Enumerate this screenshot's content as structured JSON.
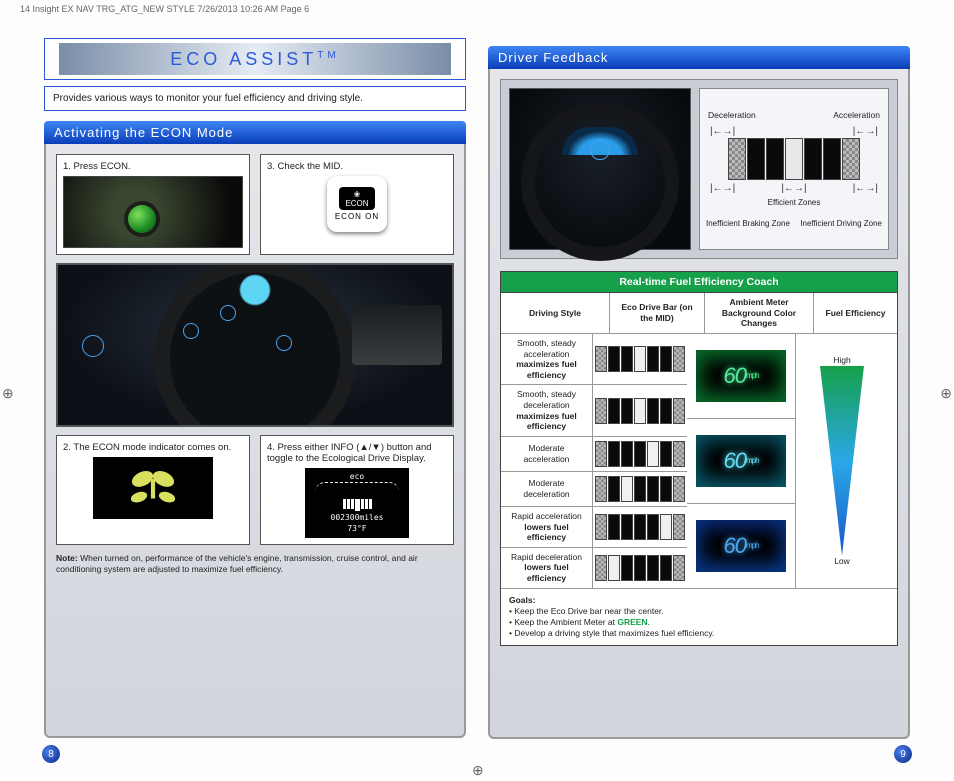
{
  "header": "14 Insight EX NAV TRG_ATG_NEW STYLE  7/26/2013  10:26 AM  Page 6",
  "left": {
    "title": "ECO ASSIST",
    "tm": "TM",
    "intro": "Provides various ways to monitor your fuel efficiency and driving style.",
    "section": "Activating the ECON Mode",
    "step1": "1.  Press ECON.",
    "step2_a": "2.  The ECON mode indicator comes on.",
    "step3": "3.  Check the MID.",
    "mid_icon_label": "ECON",
    "mid_icon_on": "ECON ON",
    "step4": "4.  Press either INFO (▲/▼) button and toggle to the Ecological Drive Display.",
    "eco_disp_top": "eco",
    "eco_disp_odo": "002300miles",
    "eco_disp_temp": "73°F",
    "note_b": "Note:",
    "note": " When turned on, performance of the vehicle's engine, transmission, cruise control, and air conditioning system are adjusted to maximize fuel efficiency.",
    "page": "8"
  },
  "right": {
    "section": "Driver Feedback",
    "zones": {
      "decel": "Deceleration",
      "accel": "Acceleration",
      "eff": "Efficient Zones",
      "ineff_brake": "Inefficient Braking Zone",
      "ineff_drive": "Inefficient Driving Zone"
    },
    "table": {
      "title": "Real-time Fuel Efficiency Coach",
      "headers": [
        "Driving Style",
        "Eco Drive Bar (on the MID)",
        "Ambient Meter Background Color Changes",
        "Fuel Efficiency"
      ],
      "rows": [
        {
          "style_a": "Smooth, steady acceleration",
          "style_b": "maximizes fuel efficiency"
        },
        {
          "style_a": "Smooth, steady deceleration",
          "style_b": "maximizes fuel efficiency"
        },
        {
          "style_a": "Moderate acceleration",
          "style_b": ""
        },
        {
          "style_a": "Moderate deceleration",
          "style_b": ""
        },
        {
          "style_a": "Rapid acceleration",
          "style_b": "lowers fuel efficiency"
        },
        {
          "style_a": "Rapid deceleration",
          "style_b": "lowers fuel efficiency"
        }
      ],
      "amb_value": "60",
      "amb_unit": "mph",
      "eff_high": "High",
      "eff_low": "Low"
    },
    "goals": {
      "title": "Goals:",
      "g1": "• Keep the Eco Drive bar near the center.",
      "g2a": "• Keep the Ambient Meter at ",
      "g2b": "GREEN",
      "g2c": ".",
      "g3": "• Develop a driving style that maximizes fuel efficiency."
    },
    "page": "9"
  }
}
